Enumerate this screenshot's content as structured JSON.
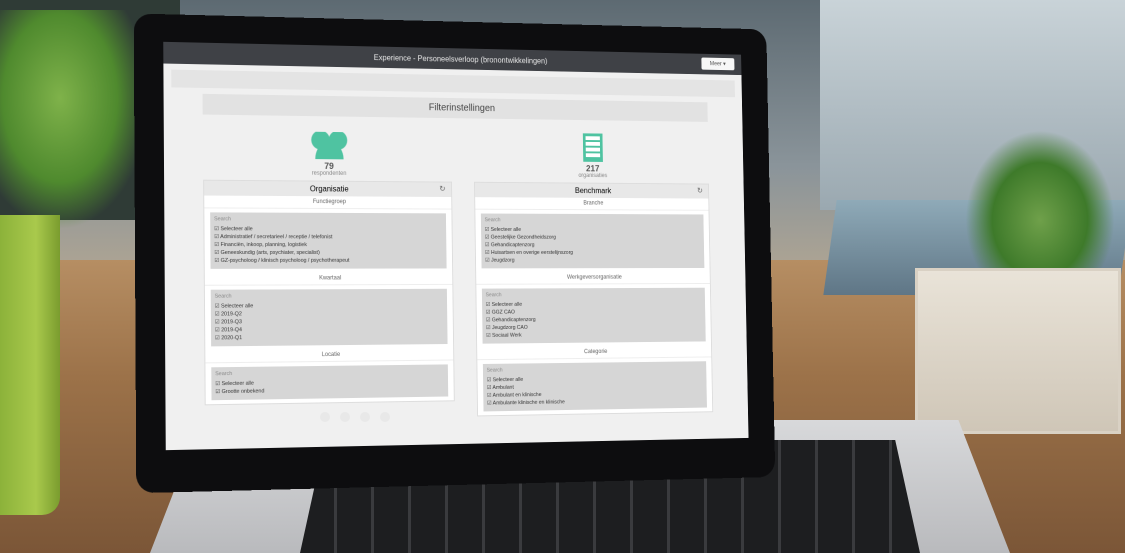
{
  "window": {
    "title": "Experience - Personeelsverloop (bronontwikkelingen)",
    "more_label": "Meer ▾"
  },
  "page": {
    "filter_title": "Filterinstellingen"
  },
  "left": {
    "count": "79",
    "count_label": "respondenten",
    "panel_title": "Organisatie",
    "sections": [
      {
        "title": "Functiegroep",
        "search": "Search",
        "options": [
          "Selecteer alle",
          "Administratief / secretarieel / receptie / telefonist",
          "Financiën, inkoop, planning, logistiek",
          "Geneeskundig (arts, psychiater, specialist)",
          "GZ-psycholoog / klinisch psycholoog / psychotherapeut"
        ]
      },
      {
        "title": "Kwartaal",
        "search": "Search",
        "options": [
          "Selecteer alle",
          "2019-Q2",
          "2019-Q3",
          "2019-Q4",
          "2020-Q1"
        ]
      },
      {
        "title": "Locatie",
        "search": "Search",
        "options": [
          "Selecteer alle",
          "Grootte onbekend"
        ]
      }
    ]
  },
  "right": {
    "count": "217",
    "count_label": "organisaties",
    "panel_title": "Benchmark",
    "sections": [
      {
        "title": "Branche",
        "search": "Search",
        "options": [
          "Selecteer alle",
          "Geestelijke Gezondheidszorg",
          "Gehandicaptenzorg",
          "Huisartsen en overige eerstelijnszorg",
          "Jeugdzorg"
        ]
      },
      {
        "title": "Werkgeversorganisatie",
        "search": "Search",
        "options": [
          "Selecteer alle",
          "GGZ CAO",
          "Gehandicaptenzorg",
          "Jeugdzorg CAO",
          "Sociaal Werk"
        ]
      },
      {
        "title": "Categorie",
        "search": "Search",
        "options": [
          "Selecteer alle",
          "Ambulant",
          "Ambulant en klinische",
          "Ambulante klinische en klinische"
        ]
      }
    ]
  },
  "icons": {
    "people": "people-icon",
    "building": "building-icon",
    "refresh": "refresh-icon",
    "dock": [
      "close-icon",
      "grid-icon",
      "print-icon",
      "settings-icon"
    ]
  }
}
